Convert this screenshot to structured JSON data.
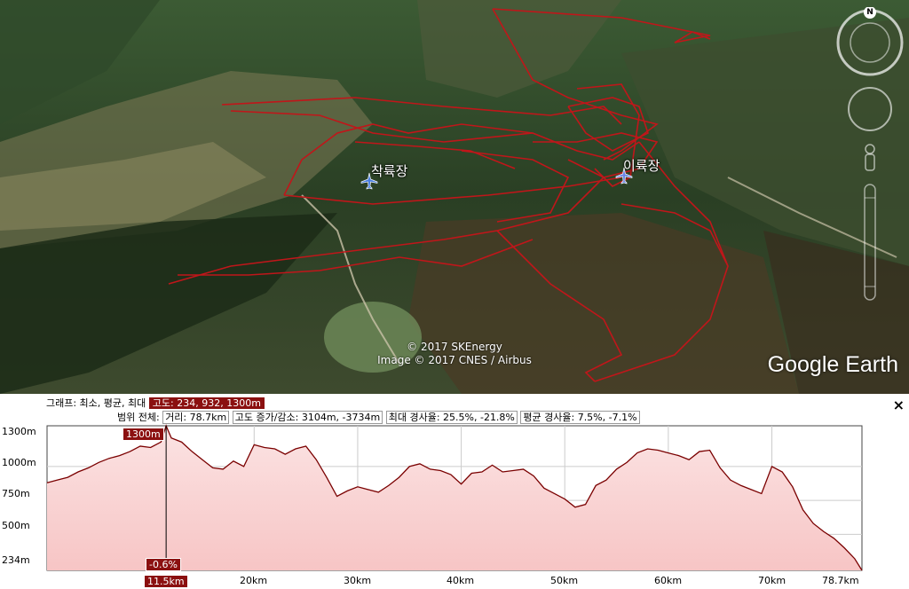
{
  "map": {
    "labels": [
      {
        "id": "left",
        "text": "착륙장"
      },
      {
        "id": "right",
        "text": "이륙장"
      }
    ],
    "attribution_1": "© 2017 SKEnergy",
    "attribution_2": "Image © 2017 CNES / Airbus",
    "brand": "Google Earth",
    "compass_letter": "N"
  },
  "elevation_panel": {
    "graph_label": "그래프: 최소, 평균, 최대",
    "graph_value": "고도: 234, 932, 1300m",
    "range_label": "범위 전체:",
    "distance": "거리: 78.7km",
    "gain_loss": "고도 증가/감소: 3104m, -3734m",
    "max_slope": "최대 경사율: 25.5%, -21.8%",
    "avg_slope": "평균 경사율: 7.5%, -7.1%",
    "close": "×",
    "y_ticks": [
      "1300m",
      "1000m",
      "750m",
      "500m",
      "234m"
    ],
    "x_ticks": [
      "11.5km",
      "20km",
      "30km",
      "40km",
      "50km",
      "60km",
      "70km",
      "78.7km"
    ],
    "cursor_value": "1300m",
    "cursor_slope": "-0.6%"
  },
  "chart_data": {
    "type": "area",
    "title": "",
    "xlabel": "",
    "ylabel": "",
    "ylim": [
      234,
      1300
    ],
    "xlim": [
      0,
      78.7
    ],
    "x": [
      0,
      1,
      2,
      3,
      4,
      5,
      6,
      7,
      8,
      9,
      10,
      11,
      11.5,
      12,
      13,
      14,
      15,
      16,
      17,
      18,
      19,
      20,
      21,
      22,
      23,
      24,
      25,
      26,
      27,
      28,
      29,
      30,
      31,
      32,
      33,
      34,
      35,
      36,
      37,
      38,
      39,
      40,
      41,
      42,
      43,
      44,
      45,
      46,
      47,
      48,
      49,
      50,
      51,
      52,
      53,
      54,
      55,
      56,
      57,
      58,
      59,
      60,
      61,
      62,
      63,
      64,
      65,
      66,
      67,
      68,
      69,
      70,
      71,
      72,
      73,
      74,
      75,
      76,
      77,
      78,
      78.7
    ],
    "series": [
      {
        "values": [
          880,
          900,
          920,
          960,
          990,
          1030,
          1060,
          1080,
          1110,
          1150,
          1140,
          1180,
          1300,
          1210,
          1180,
          1110,
          1050,
          990,
          980,
          1040,
          1000,
          1160,
          1140,
          1130,
          1090,
          1130,
          1150,
          1050,
          920,
          780,
          820,
          850,
          830,
          810,
          860,
          920,
          1000,
          1020,
          980,
          970,
          940,
          870,
          950,
          960,
          1010,
          960,
          970,
          980,
          930,
          840,
          800,
          760,
          700,
          720,
          860,
          900,
          980,
          1030,
          1100,
          1130,
          1120,
          1100,
          1080,
          1050,
          1110,
          1120,
          990,
          900,
          860,
          830,
          800,
          1000,
          960,
          850,
          680,
          580,
          520,
          470,
          400,
          320,
          234
        ]
      }
    ],
    "cursor_x": 11.5,
    "grid": true,
    "fill_color": "#f7c5c5",
    "line_color": "#7a0000"
  }
}
